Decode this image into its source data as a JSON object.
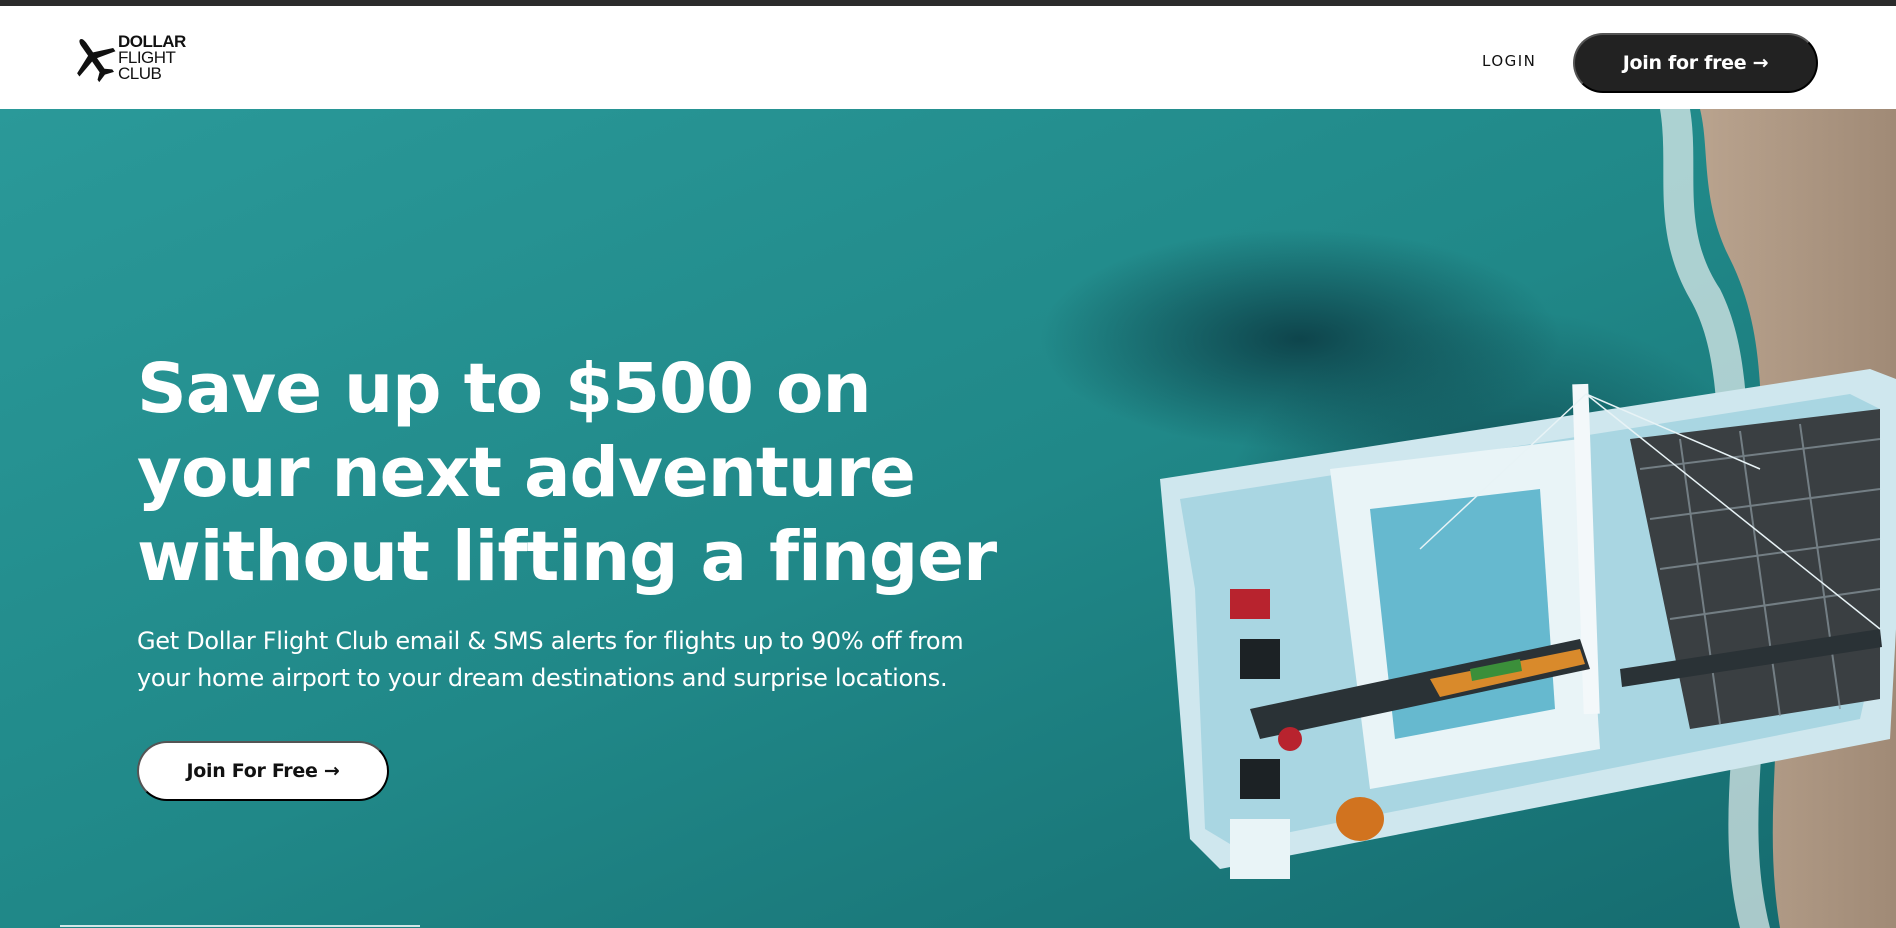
{
  "header": {
    "logo": {
      "line1": "DOLLAR",
      "line2": "FLIGHT",
      "line3": "CLUB",
      "icon": "airplane-icon"
    },
    "login_label": "LOGIN",
    "join_label": "Join for free →"
  },
  "hero": {
    "headline_lines": [
      "Save up to $500 on",
      "your next adventure",
      "without lifting a finger"
    ],
    "subtext_lines": [
      "Get Dollar Flight Club email & SMS alerts for flights up to 90% off from",
      "your home airport to your dream destinations and surprise locations."
    ],
    "cta_label": "Join For Free →"
  },
  "colors": {
    "dark": "#222222",
    "water": "#1f8585",
    "white": "#ffffff"
  }
}
